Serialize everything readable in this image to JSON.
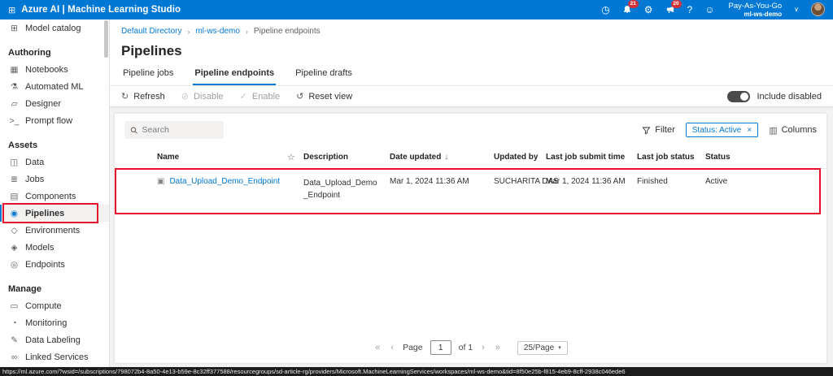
{
  "colors": {
    "accent": "#0078d4",
    "topbar": "#0078d4",
    "annotation": "#e8112d",
    "badge": "#d13438"
  },
  "icons": {
    "app": "⊞",
    "clock": "◷",
    "gear": "⚙",
    "help": "?",
    "smiley": "☺",
    "chevron_down": "∨",
    "columns": "▥",
    "star": "☆",
    "sort_desc": "↓",
    "chip_close": "×",
    "page_first": "«",
    "page_prev": "‹",
    "page_next": "›",
    "page_last": "»",
    "select_caret": "▾",
    "row": "▣"
  },
  "topbar": {
    "brand": "Azure AI | Machine Learning Studio",
    "notification_count": "21",
    "feedback_count": "20",
    "account_name": "Pay-As-You-Go",
    "workspace": "ml-ws-demo"
  },
  "sidebar": {
    "groups": [
      {
        "items": [
          {
            "label": "Model catalog",
            "icon": "model-catalog-icon",
            "glyph": "⊞"
          }
        ]
      },
      {
        "header": "Authoring",
        "items": [
          {
            "label": "Notebooks",
            "icon": "notebooks-icon",
            "glyph": "▦"
          },
          {
            "label": "Automated ML",
            "icon": "automated-ml-icon",
            "glyph": "⚗"
          },
          {
            "label": "Designer",
            "icon": "designer-icon",
            "glyph": "▱"
          },
          {
            "label": "Prompt flow",
            "icon": "prompt-flow-icon",
            "glyph": ">_"
          }
        ]
      },
      {
        "header": "Assets",
        "items": [
          {
            "label": "Data",
            "icon": "data-icon",
            "glyph": "◫"
          },
          {
            "label": "Jobs",
            "icon": "jobs-icon",
            "glyph": "≣"
          },
          {
            "label": "Components",
            "icon": "components-icon",
            "glyph": "▤"
          },
          {
            "label": "Pipelines",
            "icon": "pipelines-icon",
            "glyph": "◉",
            "selected": true,
            "annotated": true
          },
          {
            "label": "Environments",
            "icon": "environments-icon",
            "glyph": "◇"
          },
          {
            "label": "Models",
            "icon": "models-icon",
            "glyph": "◈"
          },
          {
            "label": "Endpoints",
            "icon": "endpoints-icon",
            "glyph": "◎"
          }
        ]
      },
      {
        "header": "Manage",
        "items": [
          {
            "label": "Compute",
            "icon": "compute-icon",
            "glyph": "▭"
          },
          {
            "label": "Monitoring",
            "icon": "monitoring-icon",
            "glyph": "◔"
          },
          {
            "label": "Data Labeling",
            "icon": "data-labeling-icon",
            "glyph": "✎"
          },
          {
            "label": "Linked Services",
            "icon": "linked-services-icon",
            "glyph": "∞"
          }
        ]
      }
    ]
  },
  "breadcrumb": {
    "separator": "›",
    "items": [
      "Default Directory",
      "ml-ws-demo",
      "Pipeline endpoints"
    ]
  },
  "page": {
    "title": "Pipelines"
  },
  "tabs": [
    {
      "label": "Pipeline jobs"
    },
    {
      "label": "Pipeline endpoints",
      "active": true
    },
    {
      "label": "Pipeline drafts"
    }
  ],
  "toolbar": {
    "buttons": [
      {
        "label": "Refresh",
        "icon_name": "refresh-icon",
        "glyph": "↻",
        "disabled": false
      },
      {
        "label": "Disable",
        "icon_name": "disable-icon",
        "glyph": "⊘",
        "disabled": true
      },
      {
        "label": "Enable",
        "icon_name": "enable-icon",
        "glyph": "✓",
        "disabled": true
      },
      {
        "label": "Reset view",
        "icon_name": "reset-view-icon",
        "glyph": "↺",
        "disabled": false
      }
    ],
    "include_disabled_label": "Include disabled"
  },
  "filters": {
    "search_placeholder": "Search",
    "filter_label": "Filter",
    "status_chip": "Status: Active",
    "columns_label": "Columns"
  },
  "table": {
    "columns": [
      {
        "key": "name",
        "label": "Name"
      },
      {
        "key": "description",
        "label": "Description"
      },
      {
        "key": "date_updated",
        "label": "Date updated",
        "sorted": true
      },
      {
        "key": "updated_by",
        "label": "Updated by"
      },
      {
        "key": "last_job_submit_time",
        "label": "Last job submit time"
      },
      {
        "key": "last_job_status",
        "label": "Last job status"
      },
      {
        "key": "status",
        "label": "Status"
      }
    ],
    "rows": [
      {
        "name": "Data_Upload_Demo_Endpoint",
        "description": "Data_Upload_Demo_Endpoint",
        "date_updated": "Mar 1, 2024 11:36 AM",
        "updated_by": "SUCHARITA DAS",
        "last_job_submit_time": "Mar 1, 2024 11:36 AM",
        "last_job_status": "Finished",
        "status": "Active",
        "annotated": true
      }
    ]
  },
  "pagination": {
    "page_label": "Page",
    "page_value": "1",
    "of_label": "of 1",
    "page_size": "25/Page"
  },
  "statusbar": {
    "url": "https://ml.azure.com/?wsid=/subscriptions/798072b4-8a50-4e13-b59e-8c32ff377588/resourcegroups/sd-article-rg/providers/Microsoft.MachineLearningServices/workspaces/ml-ws-demo&tid=8f50e25b-f815-4eb9-8cff-2938c046ede6"
  }
}
